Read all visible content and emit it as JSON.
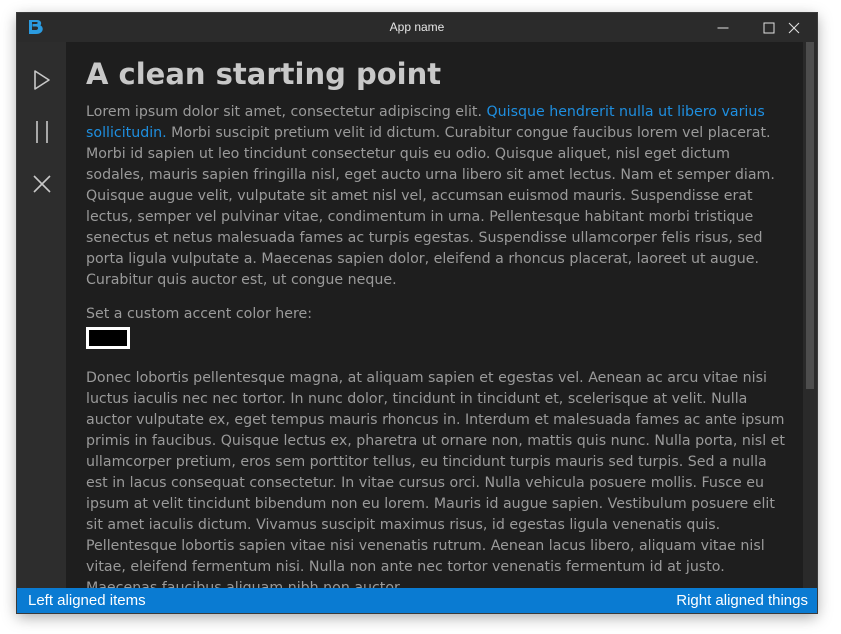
{
  "window": {
    "title": "App name",
    "logo_letter": "B",
    "controls": [
      "minimize-icon",
      "maximize-icon",
      "close-icon"
    ]
  },
  "sidebar": {
    "items": [
      {
        "icon": "play-icon"
      },
      {
        "icon": "pause-icon"
      },
      {
        "icon": "close-icon"
      }
    ]
  },
  "main": {
    "title": "A clean starting point",
    "paragraph1_before": "Lorem ipsum dolor sit amet, consectetur adipiscing elit. ",
    "paragraph1_link": "Quisque hendrerit nulla ut libero varius sollicitudin.",
    "paragraph1_after": " Morbi suscipit pretium velit id dictum. Curabitur congue faucibus lorem vel placerat. Morbi id sapien ut leo tincidunt consectetur quis eu odio. Quisque aliquet, nisl eget dictum sodales, mauris sapien fringilla nisl, eget aucto urna libero sit amet lectus. Nam et semper diam. Quisque augue velit, vulputate sit amet nisl vel, accumsan euismod mauris. Suspendisse erat lectus, semper vel pulvinar vitae, condimentum in urna. Pellentesque habitant morbi tristique senectus et netus malesuada fames ac turpis egestas. Suspendisse ullamcorper felis risus, sed porta ligula vulputate a. Maecenas sapien dolor, eleifend a rhoncus placerat, laoreet ut augue. Curabitur quis auctor est, ut congue neque.",
    "accent_label": "Set a custom accent color here:",
    "accent_color": "#000000",
    "paragraph2": "Donec lobortis pellentesque magna, at aliquam sapien et egestas vel. Aenean ac arcu vitae nisi luctus iaculis nec nec tortor. In nunc dolor, tincidunt in tincidunt et, scelerisque at velit. Nulla auctor vulputate ex, eget tempus mauris rhoncus in. Interdum et malesuada fames ac ante ipsum primis in faucibus. Quisque lectus ex, pharetra ut ornare non, mattis quis nunc. Nulla porta, nisl et ullamcorper pretium, eros sem porttitor tellus, eu tincidunt turpis mauris sed turpis. Sed a nulla est in lacus consequat consectetur. In vitae cursus orci. Nulla vehicula posuere mollis. Fusce eu ipsum at velit tincidunt bibendum non eu lorem. Mauris id augue sapien. Vestibulum posuere elit sit amet iaculis dictum. Vivamus suscipit maximus risus, id egestas ligula venenatis quis. Pellentesque lobortis sapien vitae nisi venenatis rutrum. Aenean lacus libero, aliquam vitae nisl vitae, eleifend fermentum nisi. Nulla non ante nec tortor venenatis fermentum id at justo. Maecenas faucibus aliquam nibh non auctor."
  },
  "statusbar": {
    "left": "Left aligned items",
    "right": "Right aligned things"
  },
  "colors": {
    "accent": "#0a7bd2",
    "link": "#1e8fe0",
    "background": "#1e1e1e",
    "sidebar": "#2d2d2d"
  }
}
